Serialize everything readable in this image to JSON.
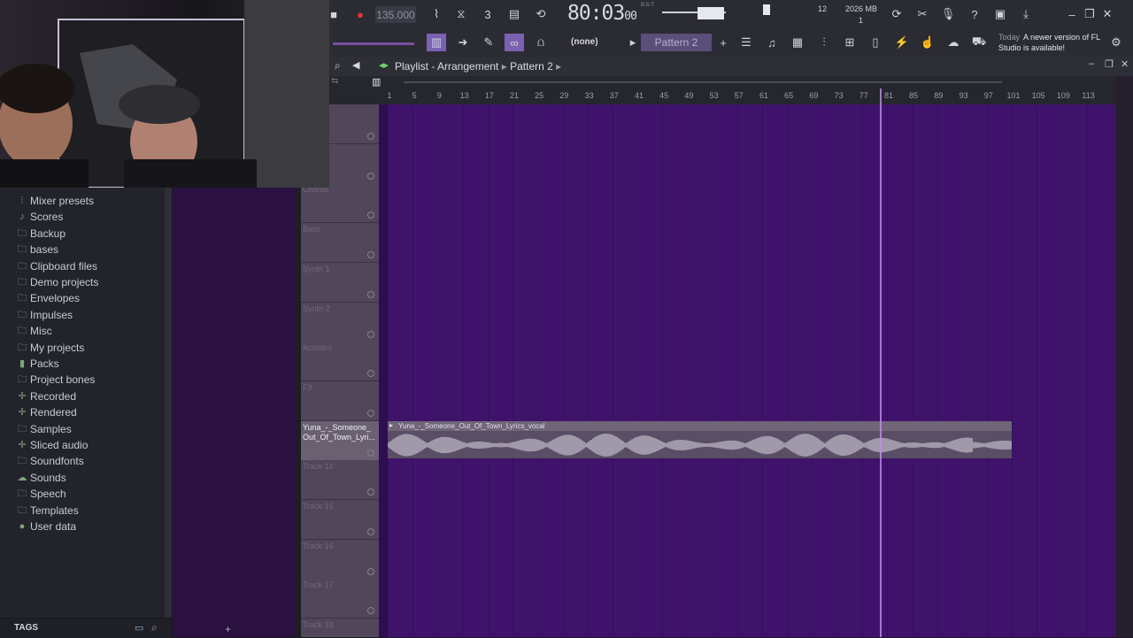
{
  "toolbar": {
    "tempo": "135.000",
    "time_main": "80:03",
    "time_sub": "00",
    "time_mode": "B:S:T",
    "cpu": "12",
    "memory": "2026 MB",
    "polyphony": "1",
    "snap": "(none)",
    "pattern": "Pattern 2",
    "news_day": "Today",
    "news_text": "A newer version of FL Studio is available!"
  },
  "browser": {
    "items": [
      {
        "label": "Mixer presets",
        "icon": "mixer-icon"
      },
      {
        "label": "Scores",
        "icon": "note-icon"
      },
      {
        "label": "Backup",
        "icon": "folder-icon"
      },
      {
        "label": "bases",
        "icon": "folder-icon"
      },
      {
        "label": "Clipboard files",
        "icon": "folder-icon"
      },
      {
        "label": "Demo projects",
        "icon": "folder-icon"
      },
      {
        "label": "Envelopes",
        "icon": "folder-icon"
      },
      {
        "label": "Impulses",
        "icon": "folder-icon"
      },
      {
        "label": "Misc",
        "icon": "folder-icon"
      },
      {
        "label": "My projects",
        "icon": "folder-icon"
      },
      {
        "label": "Packs",
        "icon": "packs-icon"
      },
      {
        "label": "Project bones",
        "icon": "folder-icon"
      },
      {
        "label": "Recorded",
        "icon": "plus-icon"
      },
      {
        "label": "Rendered",
        "icon": "plus-icon"
      },
      {
        "label": "Samples",
        "icon": "folder-icon"
      },
      {
        "label": "Sliced audio",
        "icon": "plus-icon"
      },
      {
        "label": "Soundfonts",
        "icon": "folder-icon"
      },
      {
        "label": "Sounds",
        "icon": "cloud-icon"
      },
      {
        "label": "Speech",
        "icon": "folder-icon"
      },
      {
        "label": "Templates",
        "icon": "folder-icon"
      },
      {
        "label": "User data",
        "icon": "user-icon"
      }
    ],
    "tags_label": "TAGS"
  },
  "playlist": {
    "title": "Playlist - Arrangement",
    "pattern": "Pattern 2",
    "bars": [
      "1",
      "5",
      "9",
      "13",
      "17",
      "21",
      "25",
      "29",
      "33",
      "37",
      "41",
      "45",
      "49",
      "53",
      "57",
      "61",
      "65",
      "69",
      "73",
      "77",
      "81",
      "85",
      "89",
      "93",
      "97",
      "101",
      "105",
      "109",
      "113"
    ],
    "tracks": [
      {
        "label": ""
      },
      {
        "label": ""
      },
      {
        "label": "Chords"
      },
      {
        "label": "Bass"
      },
      {
        "label": "Synth 1"
      },
      {
        "label": "Synth 2"
      },
      {
        "label": "Acordes"
      },
      {
        "label": "FX"
      },
      {
        "label": "Yuna_-_Someone_Out_Of_Town_Lyri..."
      },
      {
        "label": "Track 14"
      },
      {
        "label": "Track 15"
      },
      {
        "label": "Track 16"
      },
      {
        "label": "Track 17"
      },
      {
        "label": "Track 18"
      }
    ],
    "clip_name": "Yuna_-_Someone_Out_Of_Town_Lyrics_vocal",
    "accent": "#3f136b",
    "playhead_bar": 81
  }
}
